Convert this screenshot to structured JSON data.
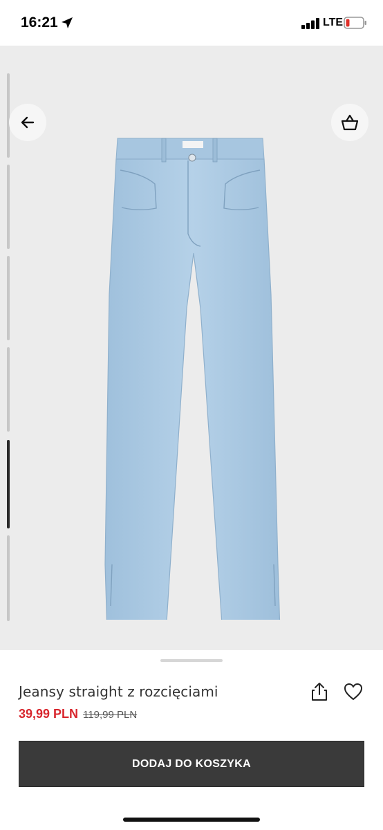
{
  "status_bar": {
    "time": "16:21",
    "network": "LTE"
  },
  "nav": {
    "back_icon": "arrow-left-icon",
    "basket_icon": "basket-icon"
  },
  "product": {
    "name": "Jeansy straight z rozcięciami",
    "price_current": "39,99 PLN",
    "price_old": "119,99 PLN",
    "color": "light-blue denim"
  },
  "actions": {
    "add_to_cart_label": "DODAJ DO KOSZYKA"
  },
  "gallery": {
    "active_index": 5
  },
  "colors": {
    "price_red": "#d8262d",
    "button_dark": "#3a3a3a",
    "denim": "#a9c8e2"
  }
}
